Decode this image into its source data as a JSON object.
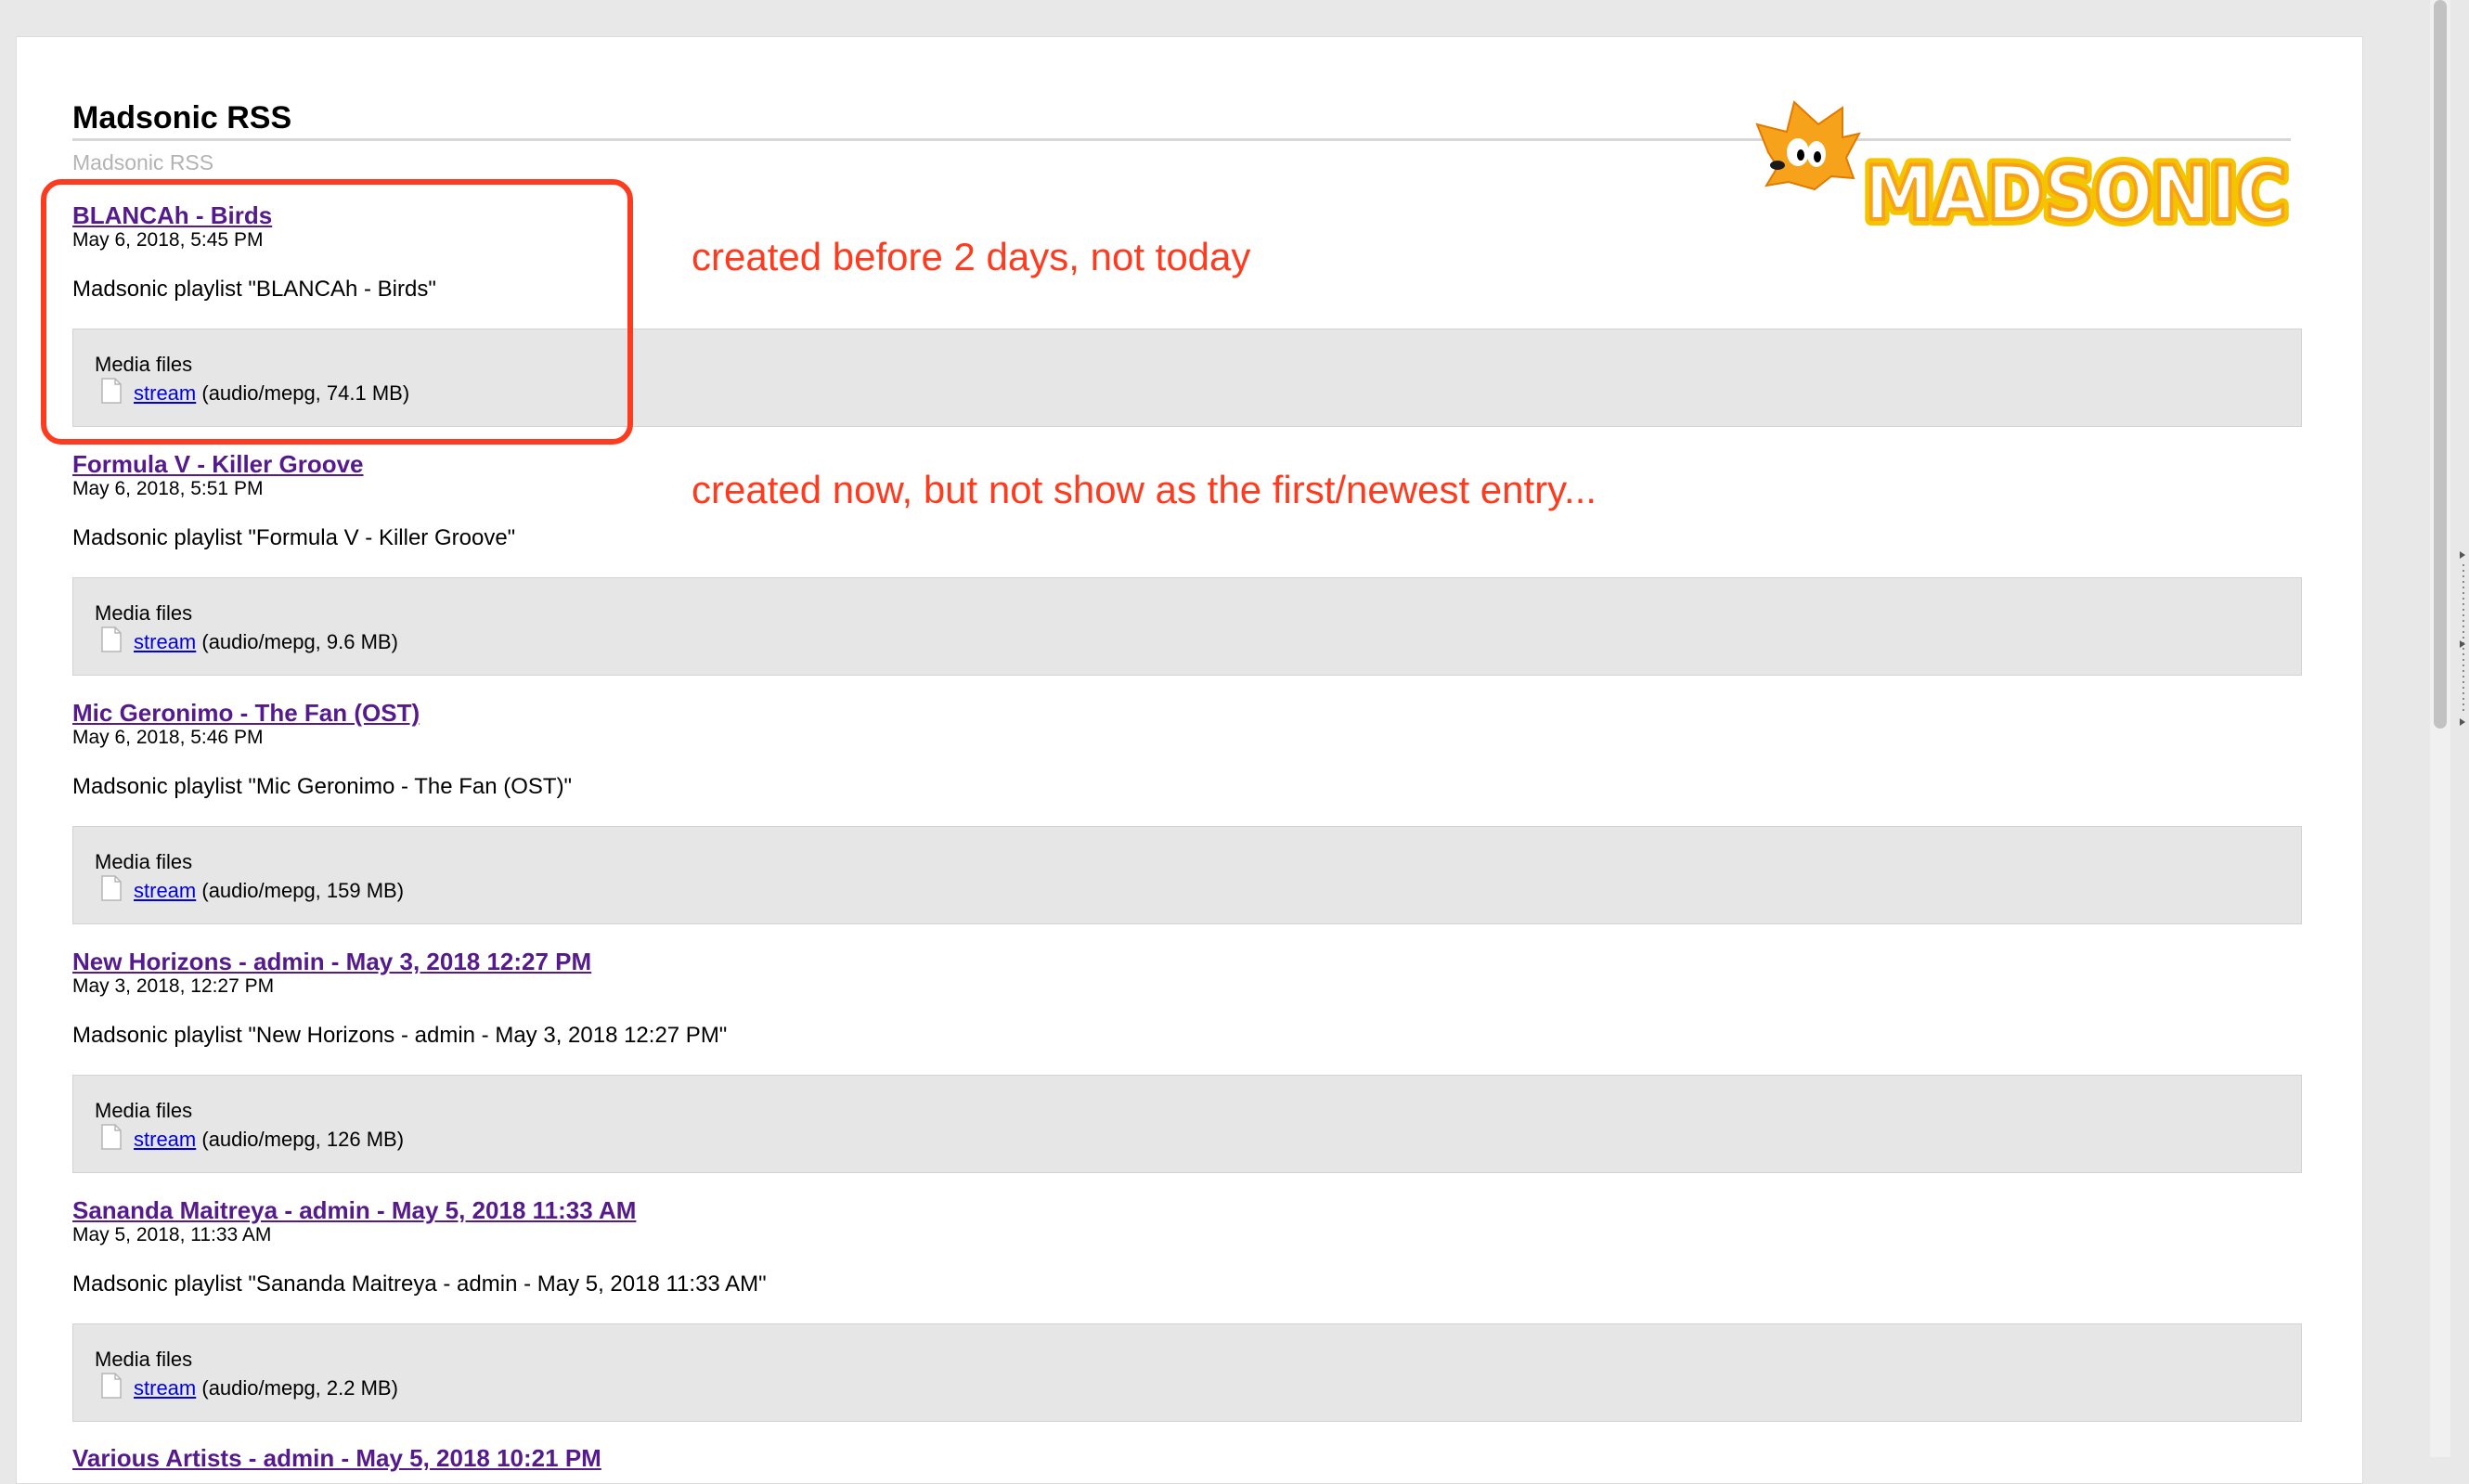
{
  "feed": {
    "title": "Madsonic RSS",
    "subtitle": "Madsonic RSS",
    "logo_text": "MADSONIC"
  },
  "media_label": "Media files",
  "entries": [
    {
      "title": "BLANCAh - Birds",
      "date": "May 6, 2018, 5:45 PM",
      "description": "Madsonic playlist \"BLANCAh - Birds\"",
      "media_files_label": "Media files",
      "link": "stream",
      "meta": "(audio/mepg, 74.1 MB)"
    },
    {
      "title": "Formula V - Killer Groove",
      "date": "May 6, 2018, 5:51 PM",
      "description": "Madsonic playlist \"Formula V - Killer Groove\"",
      "media_files_label": "Media files",
      "link": "stream",
      "meta": "(audio/mepg, 9.6 MB)"
    },
    {
      "title": "Mic Geronimo - The Fan (OST)",
      "date": "May 6, 2018, 5:46 PM",
      "description": "Madsonic playlist \"Mic Geronimo - The Fan (OST)\"",
      "media_files_label": "Media files",
      "link": "stream",
      "meta": "(audio/mepg, 159 MB)"
    },
    {
      "title": "New Horizons - admin - May 3, 2018 12:27 PM",
      "date": "May 3, 2018, 12:27 PM",
      "description": "Madsonic playlist \"New Horizons - admin - May 3, 2018 12:27 PM\"",
      "media_files_label": "Media files",
      "link": "stream",
      "meta": "(audio/mepg, 126 MB)"
    },
    {
      "title": "Sananda Maitreya - admin - May 5, 2018 11:33 AM",
      "date": "May 5, 2018, 11:33 AM",
      "description": "Madsonic playlist \"Sananda Maitreya - admin - May 5, 2018 11:33 AM\"",
      "media_files_label": "Media files",
      "link": "stream",
      "meta": "(audio/mepg, 2.2 MB)"
    },
    {
      "title": "Various Artists - admin - May 5, 2018 10:21 PM"
    }
  ],
  "annotations": {
    "first": "created before 2 days, not today",
    "second": "created now, but not show as the first/newest entry..."
  },
  "colors": {
    "annotation": "#ff3b1f",
    "visited_link": "#551a8b",
    "link": "#0000ee",
    "logo_fill": "#f7a21b",
    "logo_outline": "#f5c400"
  }
}
